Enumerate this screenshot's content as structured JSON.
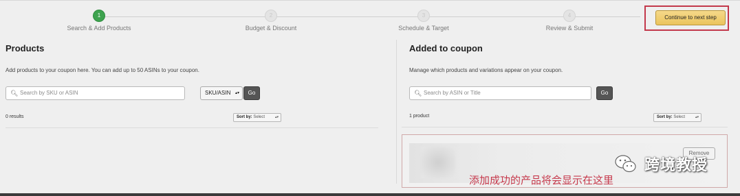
{
  "steps": [
    {
      "number": "1",
      "label": "Search & Add Products",
      "active": true
    },
    {
      "number": "2",
      "label": "Budget & Discount",
      "active": false
    },
    {
      "number": "3",
      "label": "Schedule & Target",
      "active": false
    },
    {
      "number": "4",
      "label": "Review & Submit",
      "active": false
    }
  ],
  "continue_label": "Continue to next step",
  "products_panel": {
    "title": "Products",
    "description": "Add products to your coupon here. You can add up to 50 ASINs to your coupon.",
    "search_placeholder": "Search by SKU or ASIN",
    "search_type": "SKU/ASIN",
    "go_label": "Go",
    "results": "0 results",
    "sort_label": "Sort by:",
    "sort_value": "Select"
  },
  "coupon_panel": {
    "title": "Added to coupon",
    "description": "Manage which products and variations appear on your coupon.",
    "search_placeholder": "Search by ASIN or Title",
    "go_label": "Go",
    "count": "1 product",
    "sort_label": "Sort by:",
    "sort_value": "Select",
    "remove_label": "Remove"
  },
  "annotation": "添加成功的产品将会显示在这里",
  "watermark": "跨境教授",
  "colors": {
    "active_step": "#3ea34f",
    "continue_button": "#ebc45c",
    "highlight_border": "#c2374a",
    "annotation_text": "#c6394c"
  }
}
